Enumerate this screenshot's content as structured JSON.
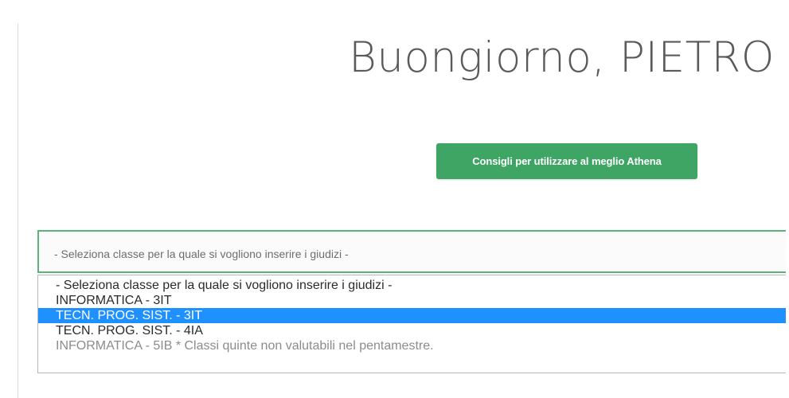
{
  "header": {
    "greeting": "Buongiorno, PIETRO"
  },
  "tips_button": {
    "label": "Consigli per utilizzare al meglio Athena",
    "color": "#3fa564"
  },
  "class_select": {
    "selected_value": "- Seleziona classe per la quale si vogliono inserire i giudizi -",
    "border_color": "#5cb37a",
    "options": [
      {
        "label": "- Seleziona classe per la quale si vogliono inserire i giudizi -",
        "state": "normal"
      },
      {
        "label": "INFORMATICA - 3IT",
        "state": "normal"
      },
      {
        "label": "TECN. PROG. SIST. - 3IT",
        "state": "highlighted"
      },
      {
        "label": "TECN. PROG. SIST. - 4IA",
        "state": "normal"
      },
      {
        "label": "INFORMATICA - 5IB * Classi quinte non valutabili nel pentamestre.",
        "state": "disabled"
      }
    ],
    "highlight_color": "#1e90ff"
  }
}
